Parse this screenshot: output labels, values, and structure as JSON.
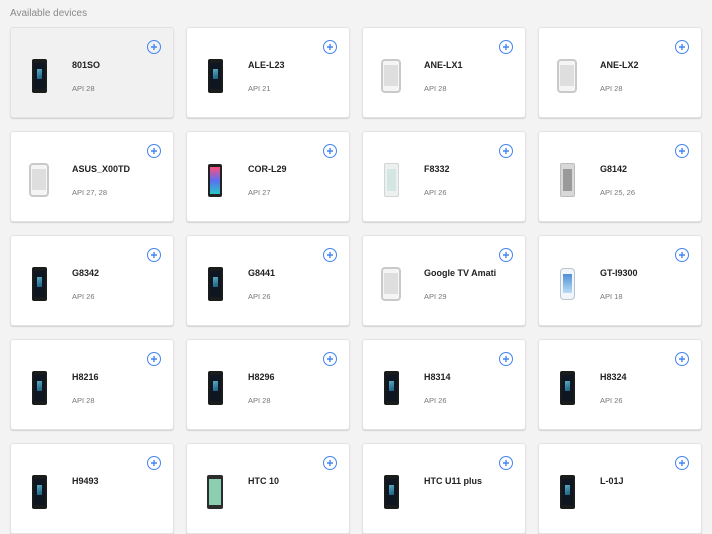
{
  "section_title": "Available devices",
  "devices": [
    {
      "name": "801SO",
      "api": "API 28",
      "icon": "phone-dark-icon"
    },
    {
      "name": "ALE-L23",
      "api": "API 21",
      "icon": "phone-dark-icon"
    },
    {
      "name": "ANE-LX1",
      "api": "API 28",
      "icon": "generic-phone-icon"
    },
    {
      "name": "ANE-LX2",
      "api": "API 28",
      "icon": "generic-phone-icon"
    },
    {
      "name": "ASUS_X00TD",
      "api": "API 27, 28",
      "icon": "generic-phone-icon"
    },
    {
      "name": "COR-L29",
      "api": "API 27",
      "icon": "phone-color-icon"
    },
    {
      "name": "F8332",
      "api": "API 26",
      "icon": "phone-white-icon"
    },
    {
      "name": "G8142",
      "api": "API 25, 26",
      "icon": "phone-silver-icon"
    },
    {
      "name": "G8342",
      "api": "API 26",
      "icon": "phone-dark-icon"
    },
    {
      "name": "G8441",
      "api": "API 26",
      "icon": "phone-dark-icon"
    },
    {
      "name": "Google TV Amati",
      "api": "API 29",
      "icon": "generic-phone-icon"
    },
    {
      "name": "GT-I9300",
      "api": "API 18",
      "icon": "phone-gt-icon"
    },
    {
      "name": "H8216",
      "api": "API 28",
      "icon": "phone-dark-icon"
    },
    {
      "name": "H8296",
      "api": "API 28",
      "icon": "phone-dark-icon"
    },
    {
      "name": "H8314",
      "api": "API 26",
      "icon": "phone-dark-icon"
    },
    {
      "name": "H8324",
      "api": "API 26",
      "icon": "phone-dark-icon"
    },
    {
      "name": "H9493",
      "api": "",
      "icon": "phone-dark-icon"
    },
    {
      "name": "HTC 10",
      "api": "",
      "icon": "phone-htc-icon"
    },
    {
      "name": "HTC U11 plus",
      "api": "",
      "icon": "phone-dark-icon"
    },
    {
      "name": "L-01J",
      "api": "",
      "icon": "phone-dark-icon"
    }
  ],
  "colors": {
    "accent": "#4285f4",
    "background": "#f3f3f3",
    "card": "#ffffff",
    "selected_card": "#f1f1f1"
  }
}
